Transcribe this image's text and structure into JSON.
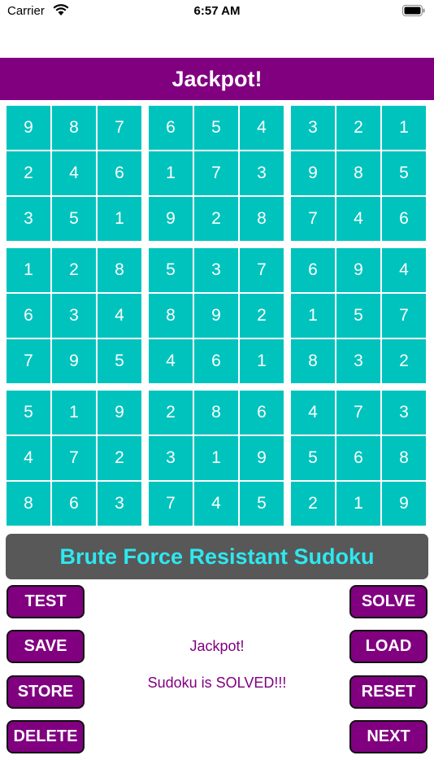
{
  "status_bar": {
    "carrier": "Carrier",
    "time": "6:57 AM"
  },
  "title": "Jackpot!",
  "grid": [
    [
      "9",
      "8",
      "7",
      "6",
      "5",
      "4",
      "3",
      "2",
      "1"
    ],
    [
      "2",
      "4",
      "6",
      "1",
      "7",
      "3",
      "9",
      "8",
      "5"
    ],
    [
      "3",
      "5",
      "1",
      "9",
      "2",
      "8",
      "7",
      "4",
      "6"
    ],
    [
      "1",
      "2",
      "8",
      "5",
      "3",
      "7",
      "6",
      "9",
      "4"
    ],
    [
      "6",
      "3",
      "4",
      "8",
      "9",
      "2",
      "1",
      "5",
      "7"
    ],
    [
      "7",
      "9",
      "5",
      "4",
      "6",
      "1",
      "8",
      "3",
      "2"
    ],
    [
      "5",
      "1",
      "9",
      "2",
      "8",
      "6",
      "4",
      "7",
      "3"
    ],
    [
      "4",
      "7",
      "2",
      "3",
      "1",
      "9",
      "5",
      "6",
      "8"
    ],
    [
      "8",
      "6",
      "3",
      "7",
      "4",
      "5",
      "2",
      "1",
      "9"
    ]
  ],
  "banner": "Brute Force Resistant Sudoku",
  "buttons": {
    "test": "TEST",
    "solve": "SOLVE",
    "save": "SAVE",
    "load": "LOAD",
    "store": "STORE",
    "reset": "RESET",
    "delete": "DELETE",
    "next": "NEXT"
  },
  "messages": {
    "line1": "Jackpot!",
    "line2": "Sudoku is SOLVED!!!"
  },
  "colors": {
    "purple": "#800080",
    "cell": "#00c3be",
    "banner_bg": "#585858",
    "banner_text": "#2de8f0"
  }
}
